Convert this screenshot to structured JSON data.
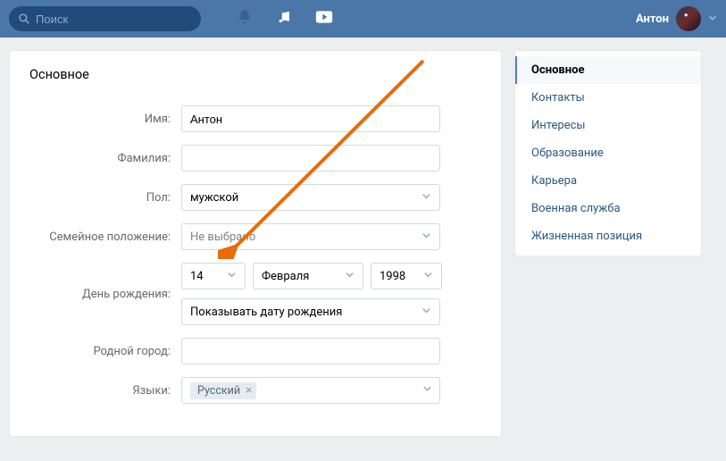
{
  "header": {
    "search_placeholder": "Поиск",
    "username": "Антон"
  },
  "page_title": "Основное",
  "form": {
    "name_label": "Имя:",
    "name_value": "Антон",
    "surname_label": "Фамилия:",
    "surname_value": "",
    "gender_label": "Пол:",
    "gender_value": "мужской",
    "relationship_label": "Семейное положение:",
    "relationship_value": "Не выбрано",
    "birthday_label": "День рождения:",
    "birthday_day": "14",
    "birthday_month": "Февраля",
    "birthday_year": "1998",
    "birthday_visibility": "Показывать дату рождения",
    "hometown_label": "Родной город:",
    "hometown_value": "",
    "languages_label": "Языки:",
    "language_tag": "Русский"
  },
  "sidebar": {
    "items": [
      "Основное",
      "Контакты",
      "Интересы",
      "Образование",
      "Карьера",
      "Военная служба",
      "Жизненная позиция"
    ]
  }
}
